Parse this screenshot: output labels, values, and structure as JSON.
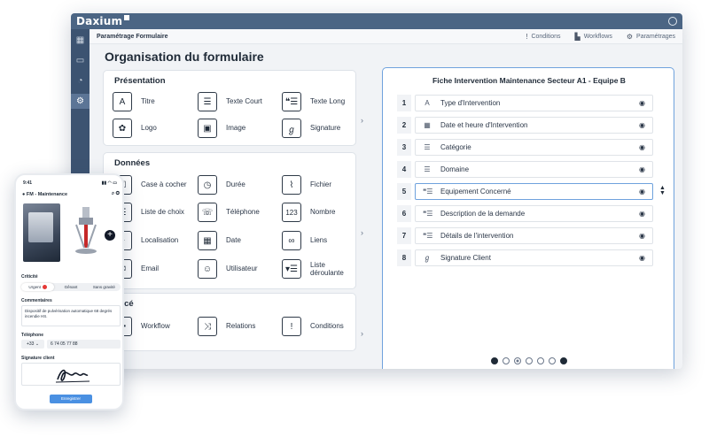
{
  "app": {
    "brand": "Daxium"
  },
  "header": {
    "title": "Paramétrage Formulaire",
    "actions": [
      {
        "label": "Conditions",
        "icon": "exclamation-icon"
      },
      {
        "label": "Workflows",
        "icon": "workflow-icon"
      },
      {
        "label": "Paramétrages",
        "icon": "gear-icon"
      }
    ]
  },
  "sidebar": {
    "items": [
      "grid-icon",
      "calendar-icon",
      "chart-icon",
      "settings-icon"
    ]
  },
  "page": {
    "title": "Organisation du formulaire"
  },
  "sections": {
    "presentation": {
      "title": "Présentation",
      "items": [
        {
          "label": "Titre",
          "icon": "A"
        },
        {
          "label": "Texte Court",
          "icon": "☰"
        },
        {
          "label": "Texte Long",
          "icon": "❝☰"
        },
        {
          "label": "Logo",
          "icon": "✿"
        },
        {
          "label": "Image",
          "icon": "▣"
        },
        {
          "label": "Signature",
          "icon": "ℊ"
        }
      ]
    },
    "donnees": {
      "title": "Données",
      "items": [
        {
          "label": "Case à cocher",
          "icon": "☑"
        },
        {
          "label": "Durée",
          "icon": "◷"
        },
        {
          "label": "Fichier",
          "icon": "⌇"
        },
        {
          "label": "Liste de choix",
          "icon": "☰"
        },
        {
          "label": "Téléphone",
          "icon": "☏"
        },
        {
          "label": "Nombre",
          "icon": "123"
        },
        {
          "label": "Localisation",
          "icon": "⌖"
        },
        {
          "label": "Date",
          "icon": "▦"
        },
        {
          "label": "Liens",
          "icon": "∞"
        },
        {
          "label": "Email",
          "icon": "✉"
        },
        {
          "label": "Utilisateur",
          "icon": "☺"
        },
        {
          "label": "Liste déroulante",
          "icon": "▾☰"
        }
      ]
    },
    "avance": {
      "title": "ancé",
      "items": [
        {
          "label": "Workflow",
          "icon": "✚"
        },
        {
          "label": "Relations",
          "icon": "⤨"
        },
        {
          "label": "Conditions",
          "icon": "!"
        }
      ]
    }
  },
  "preview": {
    "title": "Fiche Intervention Maintenance Secteur A1 - Equipe B",
    "fields": [
      {
        "num": "1",
        "label": "Type d'Intervention",
        "icon": "A"
      },
      {
        "num": "2",
        "label": "Date et heure d'Intervention",
        "icon": "▦"
      },
      {
        "num": "3",
        "label": "Catégorie",
        "icon": "☰"
      },
      {
        "num": "4",
        "label": "Domaine",
        "icon": "☰"
      },
      {
        "num": "5",
        "label": "Equipement Concerné",
        "icon": "❝☰"
      },
      {
        "num": "6",
        "label": "Description de la demande",
        "icon": "❝☰"
      },
      {
        "num": "7",
        "label": "Détails de l'intervention",
        "icon": "❝☰"
      },
      {
        "num": "8",
        "label": "Signature Client",
        "icon": "ℊ"
      }
    ],
    "selected_index": 4,
    "pages": 6,
    "current_page": 2
  },
  "phone": {
    "time": "9:41",
    "status_icons": "▮▮ ◠ ▭",
    "title": "FM - Maintenance",
    "criticite_label": "Criticité",
    "criticite_options": [
      "Urgent",
      "Gênant",
      "Sans gravité"
    ],
    "commentaires_label": "Commentaires",
    "commentaire": "Dispositif de pulvérisation automatique 68 degrés incendie HS.",
    "telephone_label": "Téléphone",
    "country_code": "+33 ⌄",
    "phone_number": "6 74 05 77 88",
    "signature_label": "Signature client",
    "save_button": "Enregistrer"
  }
}
